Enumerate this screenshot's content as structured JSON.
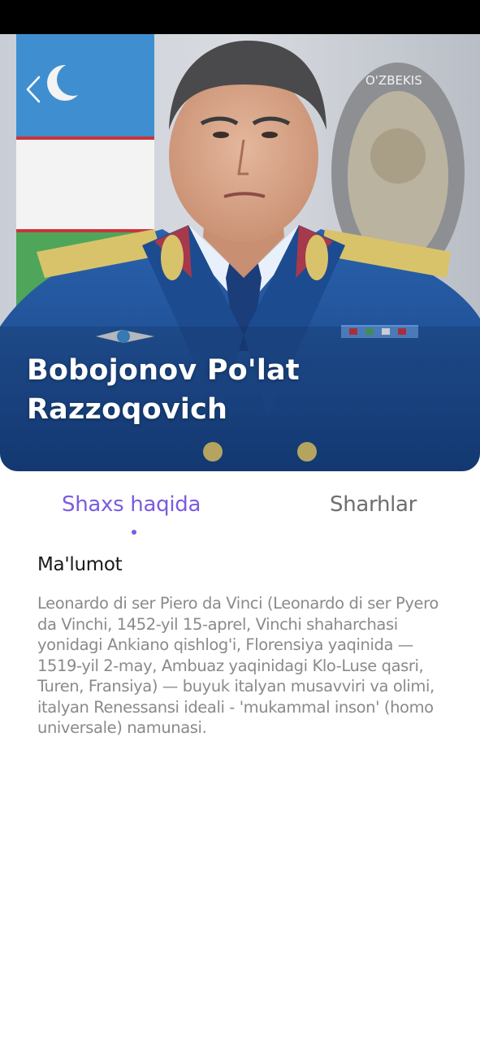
{
  "profile": {
    "name_line1": "Bobojonov Po'lat",
    "name_line2": "Razzoqovich",
    "photo_alt": "Bobojonov Po'lat Razzoqovich",
    "emblem_text": "O'ZBEKIS"
  },
  "tabs": {
    "about": "Shaxs haqida",
    "comments": "Sharhlar",
    "active": "about"
  },
  "info": {
    "title": "Ma'lumot",
    "text": "Leonardo di ser Piero da Vinci (Leonardo di ser Pyero da Vinchi, 1452-yil 15-aprel, Vinchi shaharchasi yonidagi Ankiano qishlog'i, Florensiya yaqinida — 1519-yil 2-may, Ambuaz yaqinidagi Klo-Luse qasri, Turen, Fransiya) — buyuk italyan musavviri va olimi, italyan Renessansi ideali - 'mukammal inson' (homo universale) namunasi."
  },
  "icons": {
    "back": "chevron-left-icon"
  },
  "colors": {
    "accent": "#7b5ce0",
    "inactive_tab": "#6e6e6e",
    "body_text": "#8a8a8a",
    "uniform": "#1f4f95"
  }
}
